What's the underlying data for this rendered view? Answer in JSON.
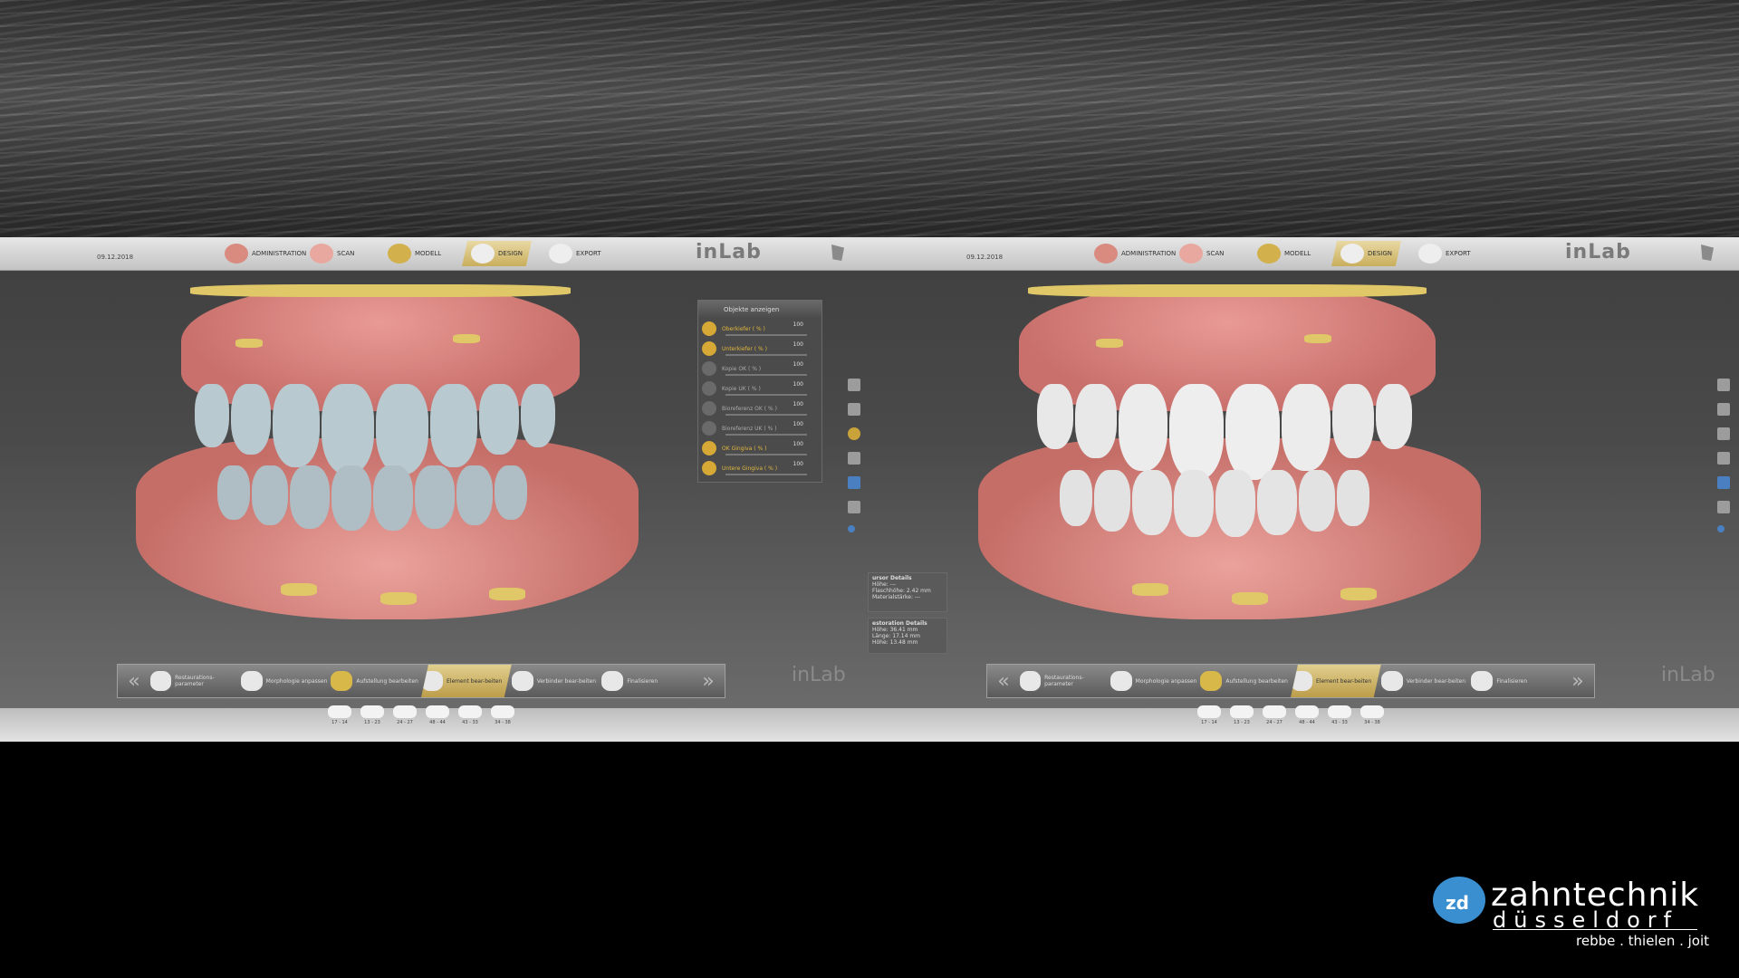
{
  "app": {
    "brand": "inLab",
    "date": "09.12.2018",
    "stages": [
      "ADMINISTRATION",
      "SCAN",
      "MODELL",
      "DESIGN",
      "EXPORT"
    ],
    "active_stage": "DESIGN"
  },
  "object_panel": {
    "header": "Objekte anzeigen",
    "rows": [
      {
        "label": "Oberkiefer ( % )",
        "value": "100",
        "on": true
      },
      {
        "label": "Unterkiefer ( % )",
        "value": "100",
        "on": true
      },
      {
        "label": "Kopie OK ( % )",
        "value": "100",
        "on": false
      },
      {
        "label": "Kopie UK ( % )",
        "value": "100",
        "on": false
      },
      {
        "label": "Bioreferenz OK ( % )",
        "value": "100",
        "on": false
      },
      {
        "label": "Bioreferenz UK ( % )",
        "value": "100",
        "on": false
      },
      {
        "label": "OK Gingiva ( % )",
        "value": "100",
        "on": true
      },
      {
        "label": "Untere Gingiva ( % )",
        "value": "100",
        "on": true
      }
    ]
  },
  "details": {
    "cursor_title": "ursor Details",
    "cursor_lines": [
      "Höhe: ---",
      "Flaschhöhe: 2.42 mm",
      "Materialstärke: ---"
    ],
    "restoration_title": "estoration Details",
    "restoration_lines": [
      "Höhe: 36.41 mm",
      "Länge: 17.14 mm",
      "Höhe: 13.48 mm"
    ]
  },
  "workflow": {
    "steps": [
      "Restaurations-parameter",
      "Morphologie anpassen",
      "Aufstellung bearbeiten",
      "Element bear-beiten",
      "Verbinder bear-beiten",
      "Finalisieren"
    ],
    "active_step": "Element bear-beiten",
    "back_arrow": "«",
    "forward_arrow": "»"
  },
  "teeth_tabs": [
    "17 - 14",
    "13 - 23",
    "24 - 27",
    "48 - 44",
    "43 - 33",
    "34 - 38"
  ],
  "footer_logo": {
    "mark": "zd",
    "name": "zahntechnik",
    "city": "düsseldorf",
    "people": "rebbe . thielen . joit"
  },
  "colors": {
    "gingiva": "#d67a75",
    "gold": "#e0c768",
    "tooth_translucent": "#b8c9cf",
    "tooth_white": "#e8e8e8",
    "accent": "#d6a836"
  }
}
